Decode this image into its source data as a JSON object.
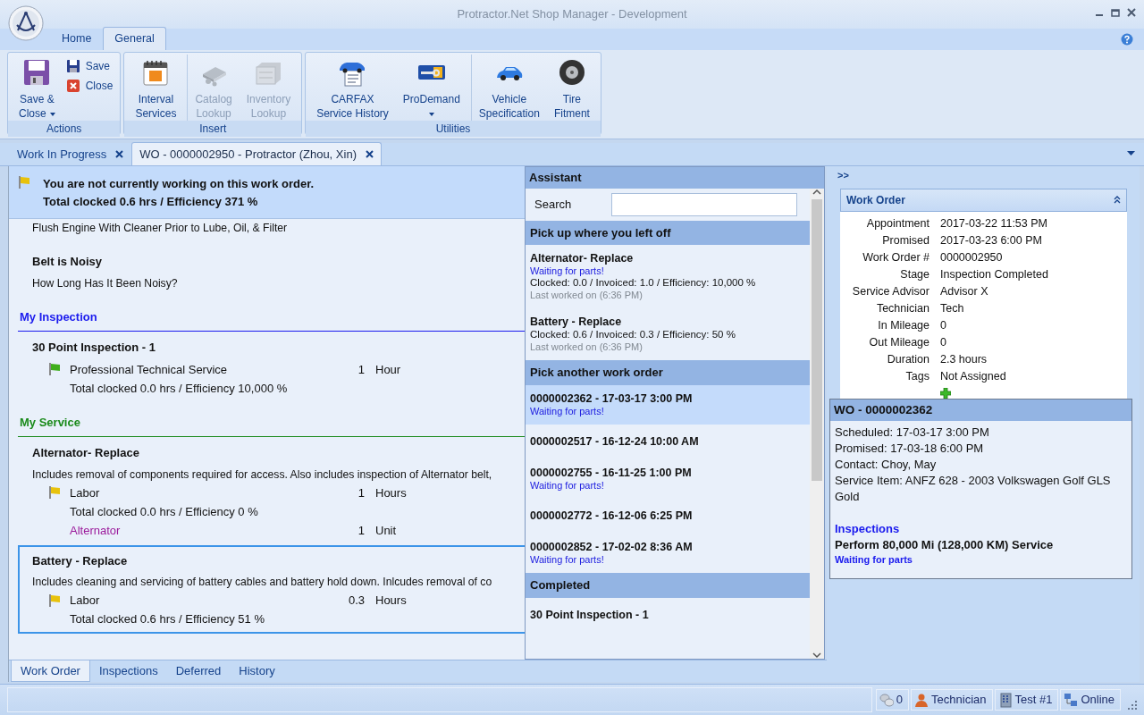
{
  "window": {
    "title": "Protractor.Net Shop Manager - Development"
  },
  "ribbon_tabs": [
    {
      "label": "Home",
      "selected": false
    },
    {
      "label": "General",
      "selected": true
    }
  ],
  "ribbon_groups": [
    {
      "label": "Actions",
      "buttons": [
        {
          "label": "Save &\nClose",
          "kind": "large",
          "dropdown": true,
          "disabled": false,
          "divider_before": false
        },
        {
          "label": "Save",
          "kind": "small",
          "dropdown": false,
          "disabled": false,
          "divider_before": false
        },
        {
          "label": "Close",
          "kind": "small",
          "dropdown": false,
          "disabled": false,
          "divider_before": false
        }
      ]
    },
    {
      "label": "Insert",
      "buttons": [
        {
          "label": "Interval\nServices",
          "kind": "large",
          "dropdown": false,
          "disabled": false,
          "divider_before": false
        },
        {
          "label": "Catalog\nLookup",
          "kind": "large",
          "dropdown": false,
          "disabled": true,
          "divider_before": true
        },
        {
          "label": "Inventory\nLookup",
          "kind": "large",
          "dropdown": false,
          "disabled": true,
          "divider_before": false
        }
      ]
    },
    {
      "label": "Utilities",
      "buttons": [
        {
          "label": "CARFAX\nService History",
          "kind": "large",
          "dropdown": false,
          "disabled": false,
          "divider_before": false
        },
        {
          "label": "ProDemand",
          "kind": "large",
          "dropdown": true,
          "disabled": false,
          "divider_before": false
        },
        {
          "label": "Vehicle\nSpecification",
          "kind": "large",
          "dropdown": false,
          "disabled": false,
          "divider_before": true
        },
        {
          "label": "Tire\nFitment",
          "kind": "large",
          "dropdown": false,
          "disabled": false,
          "divider_before": false
        }
      ]
    }
  ],
  "document_tabs": [
    {
      "label": "Work In Progress",
      "selected": false
    },
    {
      "label": "WO - 0000002950 - Protractor (Zhou, Xin)",
      "selected": true
    }
  ],
  "banner": {
    "lines": [
      "You are not currently working on this work order.",
      "Total clocked 0.6 hrs / Efficiency 371 %"
    ]
  },
  "work_order": [
    {
      "kind": "text",
      "text": "Flush Engine With Cleaner Prior to Lube, Oil, & Filter"
    },
    {
      "kind": "item",
      "title": "Belt is Noisy",
      "description": "How Long Has It Been Noisy?",
      "selected": false
    },
    {
      "kind": "section",
      "title": "My Inspection",
      "color": "#1a1aee"
    },
    {
      "kind": "item",
      "title": "30 Point Inspection - 1",
      "selected": false,
      "lines": [
        {
          "kind": "labor",
          "label": "Professional Technical Service",
          "qty": "1",
          "unit": "Hour",
          "color": "#3fae1c"
        },
        {
          "kind": "summary",
          "text": "Total clocked 0.0 hrs / Efficiency 10,000 %"
        }
      ]
    },
    {
      "kind": "section",
      "title": "My Service",
      "color": "#1a8a1a"
    },
    {
      "kind": "item",
      "title": "Alternator- Replace",
      "description": "Includes removal of components required for access. Also includes inspection of Alternator belt,",
      "selected": false,
      "lines": [
        {
          "kind": "labor",
          "label": "Labor",
          "qty": "1",
          "unit": "Hours",
          "color": "#e8c20c"
        },
        {
          "kind": "summary",
          "text": "Total clocked 0.0 hrs / Efficiency 0 %"
        },
        {
          "kind": "part",
          "label": "Alternator",
          "qty": "1",
          "unit": "Unit"
        }
      ]
    },
    {
      "kind": "item",
      "title": "Battery - Replace",
      "description": "Includes cleaning and servicing of battery cables and battery hold down. Inlcudes removal of co",
      "selected": true,
      "lines": [
        {
          "kind": "labor",
          "label": "Labor",
          "qty": "0.3",
          "unit": "Hours",
          "color": "#e8c20c"
        },
        {
          "kind": "summary",
          "text": "Total clocked 0.6 hrs / Efficiency 51 %"
        }
      ]
    }
  ],
  "assistant": {
    "title": "Assistant",
    "search": {
      "label": "Search"
    },
    "sections": [
      {
        "title": "Pick up where you left off",
        "entries": [
          {
            "title": "Alternator- Replace",
            "status": "Waiting for parts!",
            "details": "Clocked: 0.0 / Invoiced: 1.0 / Efficiency: 10,000 %",
            "last_worked": "Last worked on (6:36 PM)",
            "selected": false
          },
          {
            "title": "Battery - Replace",
            "details": "Clocked: 0.6 / Invoiced: 0.3 / Efficiency: 50 %",
            "last_worked": "Last worked on (6:36 PM)",
            "selected": false
          }
        ]
      },
      {
        "title": "Pick another work order",
        "entries": [
          {
            "title": "0000002362 - 17-03-17 3:00 PM",
            "status": "Waiting for parts!",
            "selected": true
          },
          {
            "title": "0000002517 - 16-12-24 10:00 AM",
            "selected": false
          },
          {
            "title": "0000002755 - 16-11-25 1:00 PM",
            "status": "Waiting for parts!",
            "selected": false
          },
          {
            "title": "0000002772 - 16-12-06 6:25 PM",
            "selected": false
          },
          {
            "title": "0000002852 - 17-02-02 8:36 AM",
            "status": "Waiting for parts!",
            "selected": false
          }
        ]
      },
      {
        "title": "Completed",
        "entries": [
          {
            "title": "30 Point Inspection - 1",
            "selected": false
          }
        ]
      }
    ]
  },
  "side_panel": {
    "expand": ">>",
    "card": {
      "title": "Work Order",
      "fields": [
        {
          "label": "Appointment",
          "value": "2017-03-22 11:53 PM"
        },
        {
          "label": "Promised",
          "value": "2017-03-23 6:00 PM"
        },
        {
          "label": "Work Order #",
          "value": "0000002950"
        },
        {
          "label": "Stage",
          "value": "Inspection Completed"
        },
        {
          "label": "Service Advisor",
          "value": "Advisor X"
        },
        {
          "label": "Technician",
          "value": "Tech"
        },
        {
          "label": "In Mileage",
          "value": "0"
        },
        {
          "label": "Out Mileage",
          "value": "0"
        },
        {
          "label": "Duration",
          "value": "2.3 hours"
        },
        {
          "label": "Tags",
          "value": "Not Assigned"
        }
      ]
    },
    "popup": {
      "title": "WO - 0000002362",
      "lines": [
        "Scheduled: 17-03-17 3:00 PM",
        "Promised: 17-03-18 6:00 PM",
        "Contact: Choy, May",
        "Service Item: ANFZ 628 - 2003 Volkswagen Golf GLS Gold"
      ],
      "inspections_heading": "Inspections",
      "inspection": "Perform 80,000 Mi (128,000 KM) Service",
      "status": "Waiting for parts"
    }
  },
  "bottom_tabs": [
    {
      "label": "Work Order",
      "selected": true
    },
    {
      "label": "Inspections",
      "selected": false
    },
    {
      "label": "Deferred",
      "selected": false
    },
    {
      "label": "History",
      "selected": false
    }
  ],
  "status_bar": [
    {
      "text": "0"
    },
    {
      "text": "Technician"
    },
    {
      "text": "Test #1"
    },
    {
      "text": "Online"
    }
  ]
}
